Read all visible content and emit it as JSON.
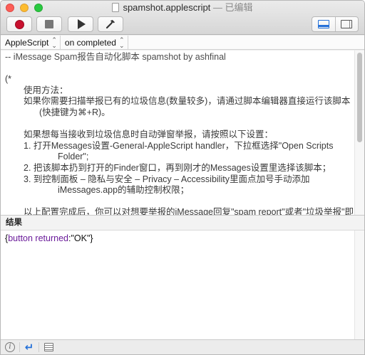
{
  "window": {
    "title": "spamshot.applescript",
    "edited_label": "— 已编辑"
  },
  "toolbar": {
    "record_icon": "record-icon",
    "stop_icon": "stop-icon",
    "run_icon": "play-icon",
    "compile_icon": "hammer-icon",
    "view_options": [
      "show-result-pane-icon",
      "show-sidebar-icon"
    ],
    "view_selected": "show-result-pane-icon",
    "record_color": "#c8102e"
  },
  "navbar": {
    "language": "AppleScript",
    "handler": "on completed"
  },
  "editor": {
    "lines": [
      "-- iMessage Spam报告自动化脚本 spamshot by ashfinal",
      "",
      "(*",
      "使用方法：",
      "如果你需要扫描举报已有的垃圾信息(数量较多)，请通过脚本编辑器直接运行该脚本(快捷键为⌘+R)。",
      "",
      "如果想每当接收到垃圾信息时自动弹窗举报，请按照以下设置：",
      "1. 打开Messages设置-General-AppleScript handler，下拉框选择\"Open Scripts Folder\";",
      "2. 把该脚本扔到打开的Finder窗口，再到刚才的Messages设置里选择该脚本；",
      "3. 到控制面板 – 隐私与安全 – Privacy – Accessibility里面点加号手动添加iMessages.app的辅助控制权限；",
      "",
      "以上配置完成后，你可以对想要举报的iMessage回复\"spam report\"或者\"垃圾举报\"即可实现自动化举报。Y(^_^)Y",
      "*)"
    ]
  },
  "result_pane": {
    "header": "结果",
    "open_brace": "{",
    "key": "button returned",
    "colon": ":",
    "value": "\"OK\"",
    "close_brace": "}"
  },
  "bottom_bar": {
    "icons": [
      "info-icon",
      "reply-icon",
      "log-icon"
    ]
  }
}
